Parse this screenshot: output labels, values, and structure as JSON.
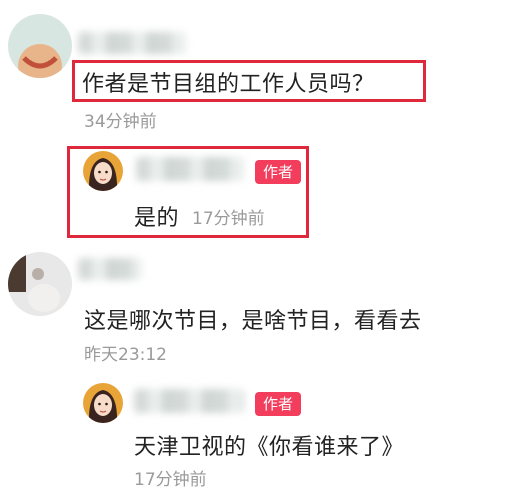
{
  "colors": {
    "badge_bg": "#f23d5c",
    "highlight_border": "#e0283c",
    "time_text": "#9a9a9a",
    "body_text": "#222222"
  },
  "comments": [
    {
      "text": "作者是节目组的工作人员吗？",
      "time": "34分钟前",
      "highlighted": true,
      "reply": {
        "badge": "作者",
        "text": "是的",
        "time": "17分钟前",
        "highlighted": true
      }
    },
    {
      "text": "这是哪次节目，是啥节目，看看去",
      "time": "昨天23:12",
      "reply": {
        "badge": "作者",
        "text": "天津卫视的《你看谁来了》",
        "time": "17分钟前"
      }
    }
  ]
}
